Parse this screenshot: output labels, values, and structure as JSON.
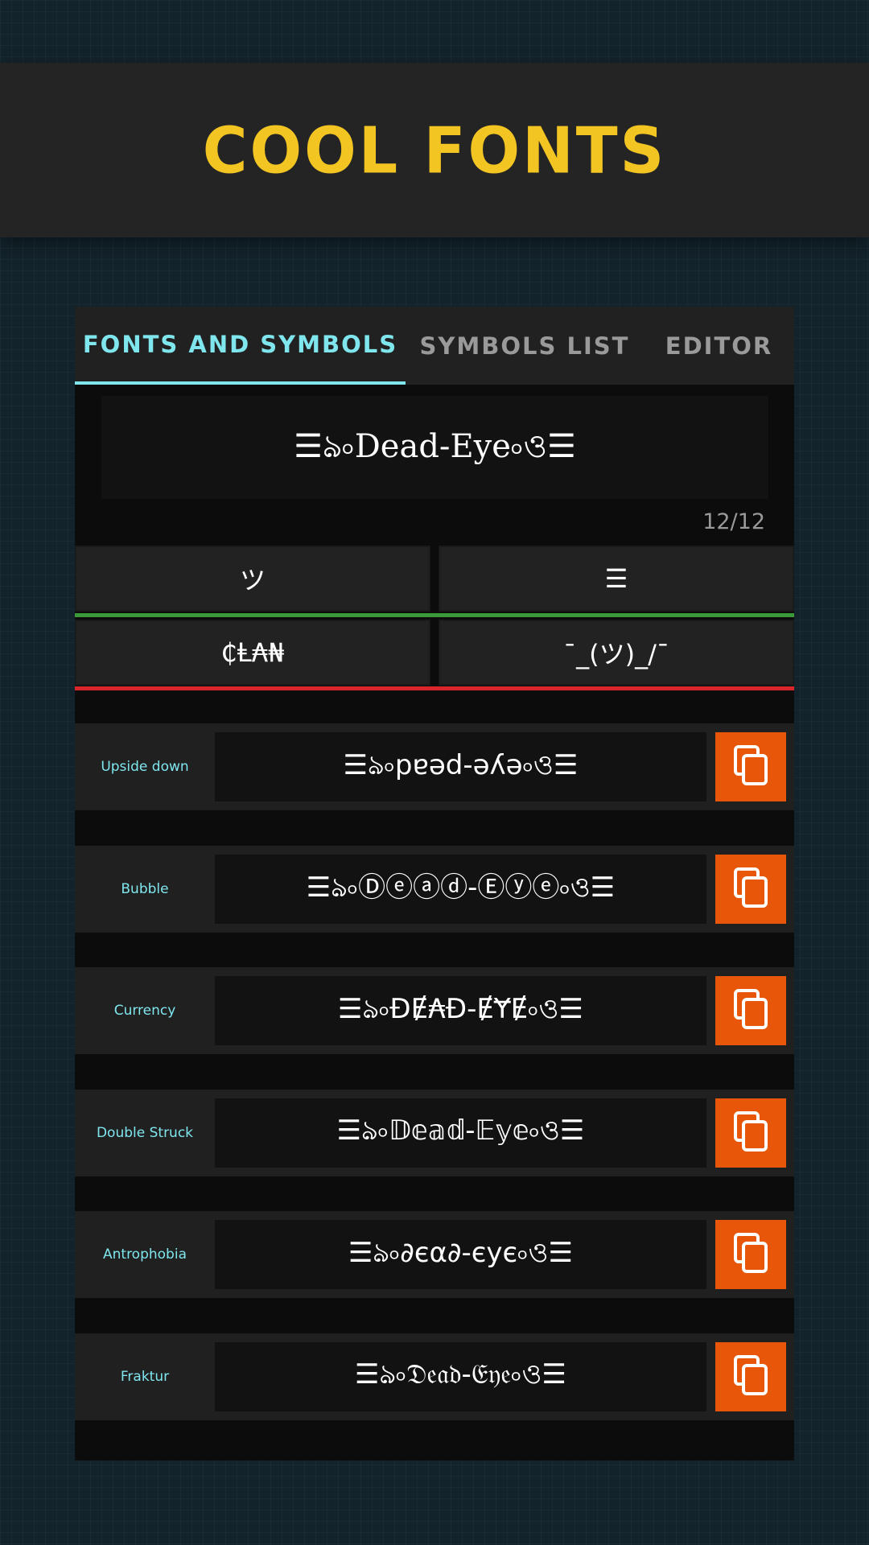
{
  "banner": {
    "title": "COOL FONTS",
    "color": "#f2c523"
  },
  "tabs": [
    {
      "label": "FONTS AND SYMBOLS",
      "active": true
    },
    {
      "label": "SYMBOLS LIST"
    },
    {
      "label": "EDITOR"
    }
  ],
  "preview": {
    "text": "☰ঌ৹Dead-Eye৹ও☰",
    "counter": "12/12"
  },
  "symbols": [
    {
      "text": "ツ"
    },
    {
      "text": "☰"
    },
    {
      "text": "₵Ⱡ₳₦"
    },
    {
      "text": "¯_(ツ)_/¯"
    }
  ],
  "divider_colors": [
    "#3a9a3a",
    "#d8262a"
  ],
  "fonts": [
    {
      "label": "Upside down",
      "text": "☰ঌ৹pɐǝd-ǝʎǝ৹ও☰"
    },
    {
      "label": "Bubble",
      "text": "☰ঌ৹Ⓓⓔⓐⓓ-Ⓔⓨⓔ৹ও☰"
    },
    {
      "label": "Currency",
      "text": "☰ঌ৹ĐɆ₳Đ-ɆɎɆ৹ও☰"
    },
    {
      "label": "Double Struck",
      "text": "☰ঌ৹𝔻𝕖𝕒𝕕-𝔼𝕪𝕖৹ও☰"
    },
    {
      "label": "Antrophobia",
      "text": "☰ঌ৹∂єα∂-єує৹ও☰"
    },
    {
      "label": "Fraktur",
      "text": "☰ঌ৹𝔇𝔢𝔞𝔡-𝔈𝔶𝔢৹ও☰"
    }
  ],
  "copy_icon": "copy-icon",
  "accent": "#e8560a"
}
